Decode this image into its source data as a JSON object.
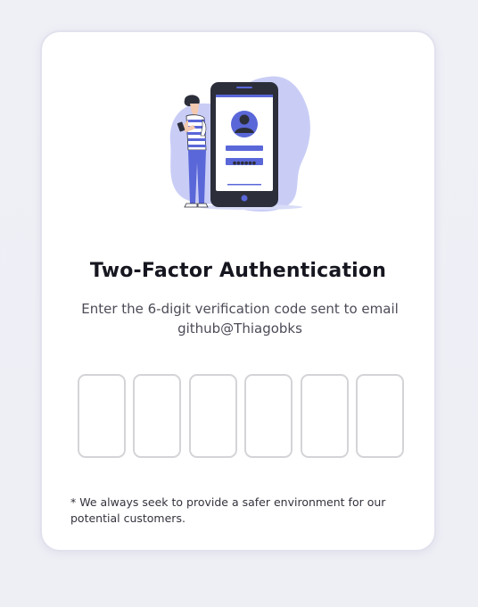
{
  "auth": {
    "title": "Two-Factor Authentication",
    "subtitle_line1": "Enter the 6-digit verification code sent to email",
    "subtitle_line2": "github@Thiagobks",
    "code_digits": [
      "",
      "",
      "",
      "",
      "",
      ""
    ],
    "note": "* We always seek to provide a safer environment for our potential customers."
  },
  "illustration": {
    "icon": "person-with-phone-login-illustration",
    "password_mask": "●●●●●●"
  },
  "colors": {
    "accent": "#5a67d8",
    "blob": "#c9cdf6",
    "phone_body": "#2c2f3a",
    "input_border": "#d4d4d8",
    "title": "#161620"
  }
}
